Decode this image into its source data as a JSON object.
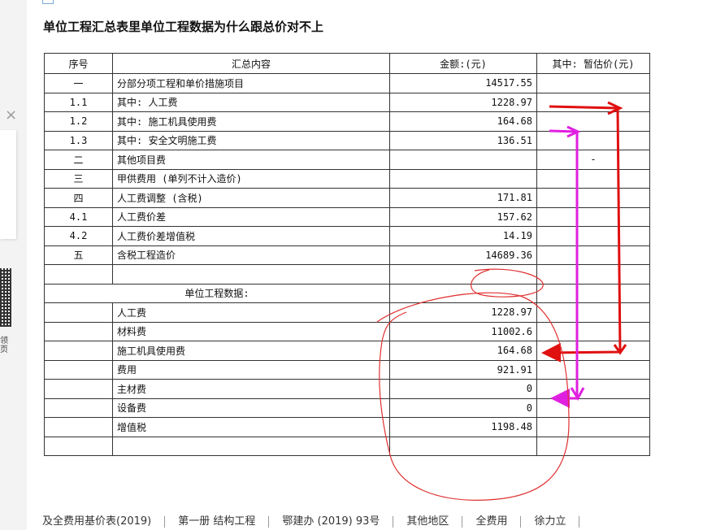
{
  "side_panel": {
    "close_symbol": "×",
    "text": "领 页"
  },
  "title": "单位工程汇总表里单位工程数据为什么跟总价对不上",
  "table": {
    "headers": [
      "序号",
      "汇总内容",
      "金额:(元)",
      "其中: 暂估价(元)"
    ],
    "rows": [
      {
        "no": "一",
        "desc": "分部分项工程和单价措施项目",
        "amount": "14517.55",
        "est": ""
      },
      {
        "no": "1.1",
        "desc": "其中: 人工费",
        "amount": "1228.97",
        "est": ""
      },
      {
        "no": "1.2",
        "desc": "其中: 施工机具使用费",
        "amount": "164.68",
        "est": ""
      },
      {
        "no": "1.3",
        "desc": "其中: 安全文明施工费",
        "amount": "136.51",
        "est": ""
      },
      {
        "no": "二",
        "desc": "其他项目费",
        "amount": "",
        "est": "-"
      },
      {
        "no": "三",
        "desc": "甲供费用 (单列不计入造价)",
        "amount": "",
        "est": ""
      },
      {
        "no": "四",
        "desc": "人工费调整 (含税)",
        "amount": "171.81",
        "est": ""
      },
      {
        "no": "4.1",
        "desc": "人工费价差",
        "amount": "157.62",
        "est": ""
      },
      {
        "no": "4.2",
        "desc": "人工费价差增值税",
        "amount": "14.19",
        "est": ""
      },
      {
        "no": "五",
        "desc": "含税工程造价",
        "amount": "14689.36",
        "est": ""
      },
      {
        "no": "",
        "desc": "",
        "amount": "",
        "est": ""
      }
    ],
    "unit_section_title": "单位工程数据:",
    "unit_rows": [
      {
        "desc": "人工费",
        "amount": "1228.97"
      },
      {
        "desc": "材料费",
        "amount": "11002.6"
      },
      {
        "desc": "施工机具使用费",
        "amount": "164.68"
      },
      {
        "desc": "费用",
        "amount": "921.91"
      },
      {
        "desc": "主材费",
        "amount": "0"
      },
      {
        "desc": "设备费",
        "amount": "0"
      },
      {
        "desc": "增值税",
        "amount": "1198.48"
      }
    ]
  },
  "bottom_tags": [
    "及全费用基价表(2019)",
    "第一册 结构工程",
    "鄂建办 (2019) 93号",
    "其他地区",
    "全费用",
    "徐力立"
  ],
  "annotation_colors": {
    "red": "#e01010",
    "magenta": "#e020e0",
    "ink": "#e03030"
  }
}
